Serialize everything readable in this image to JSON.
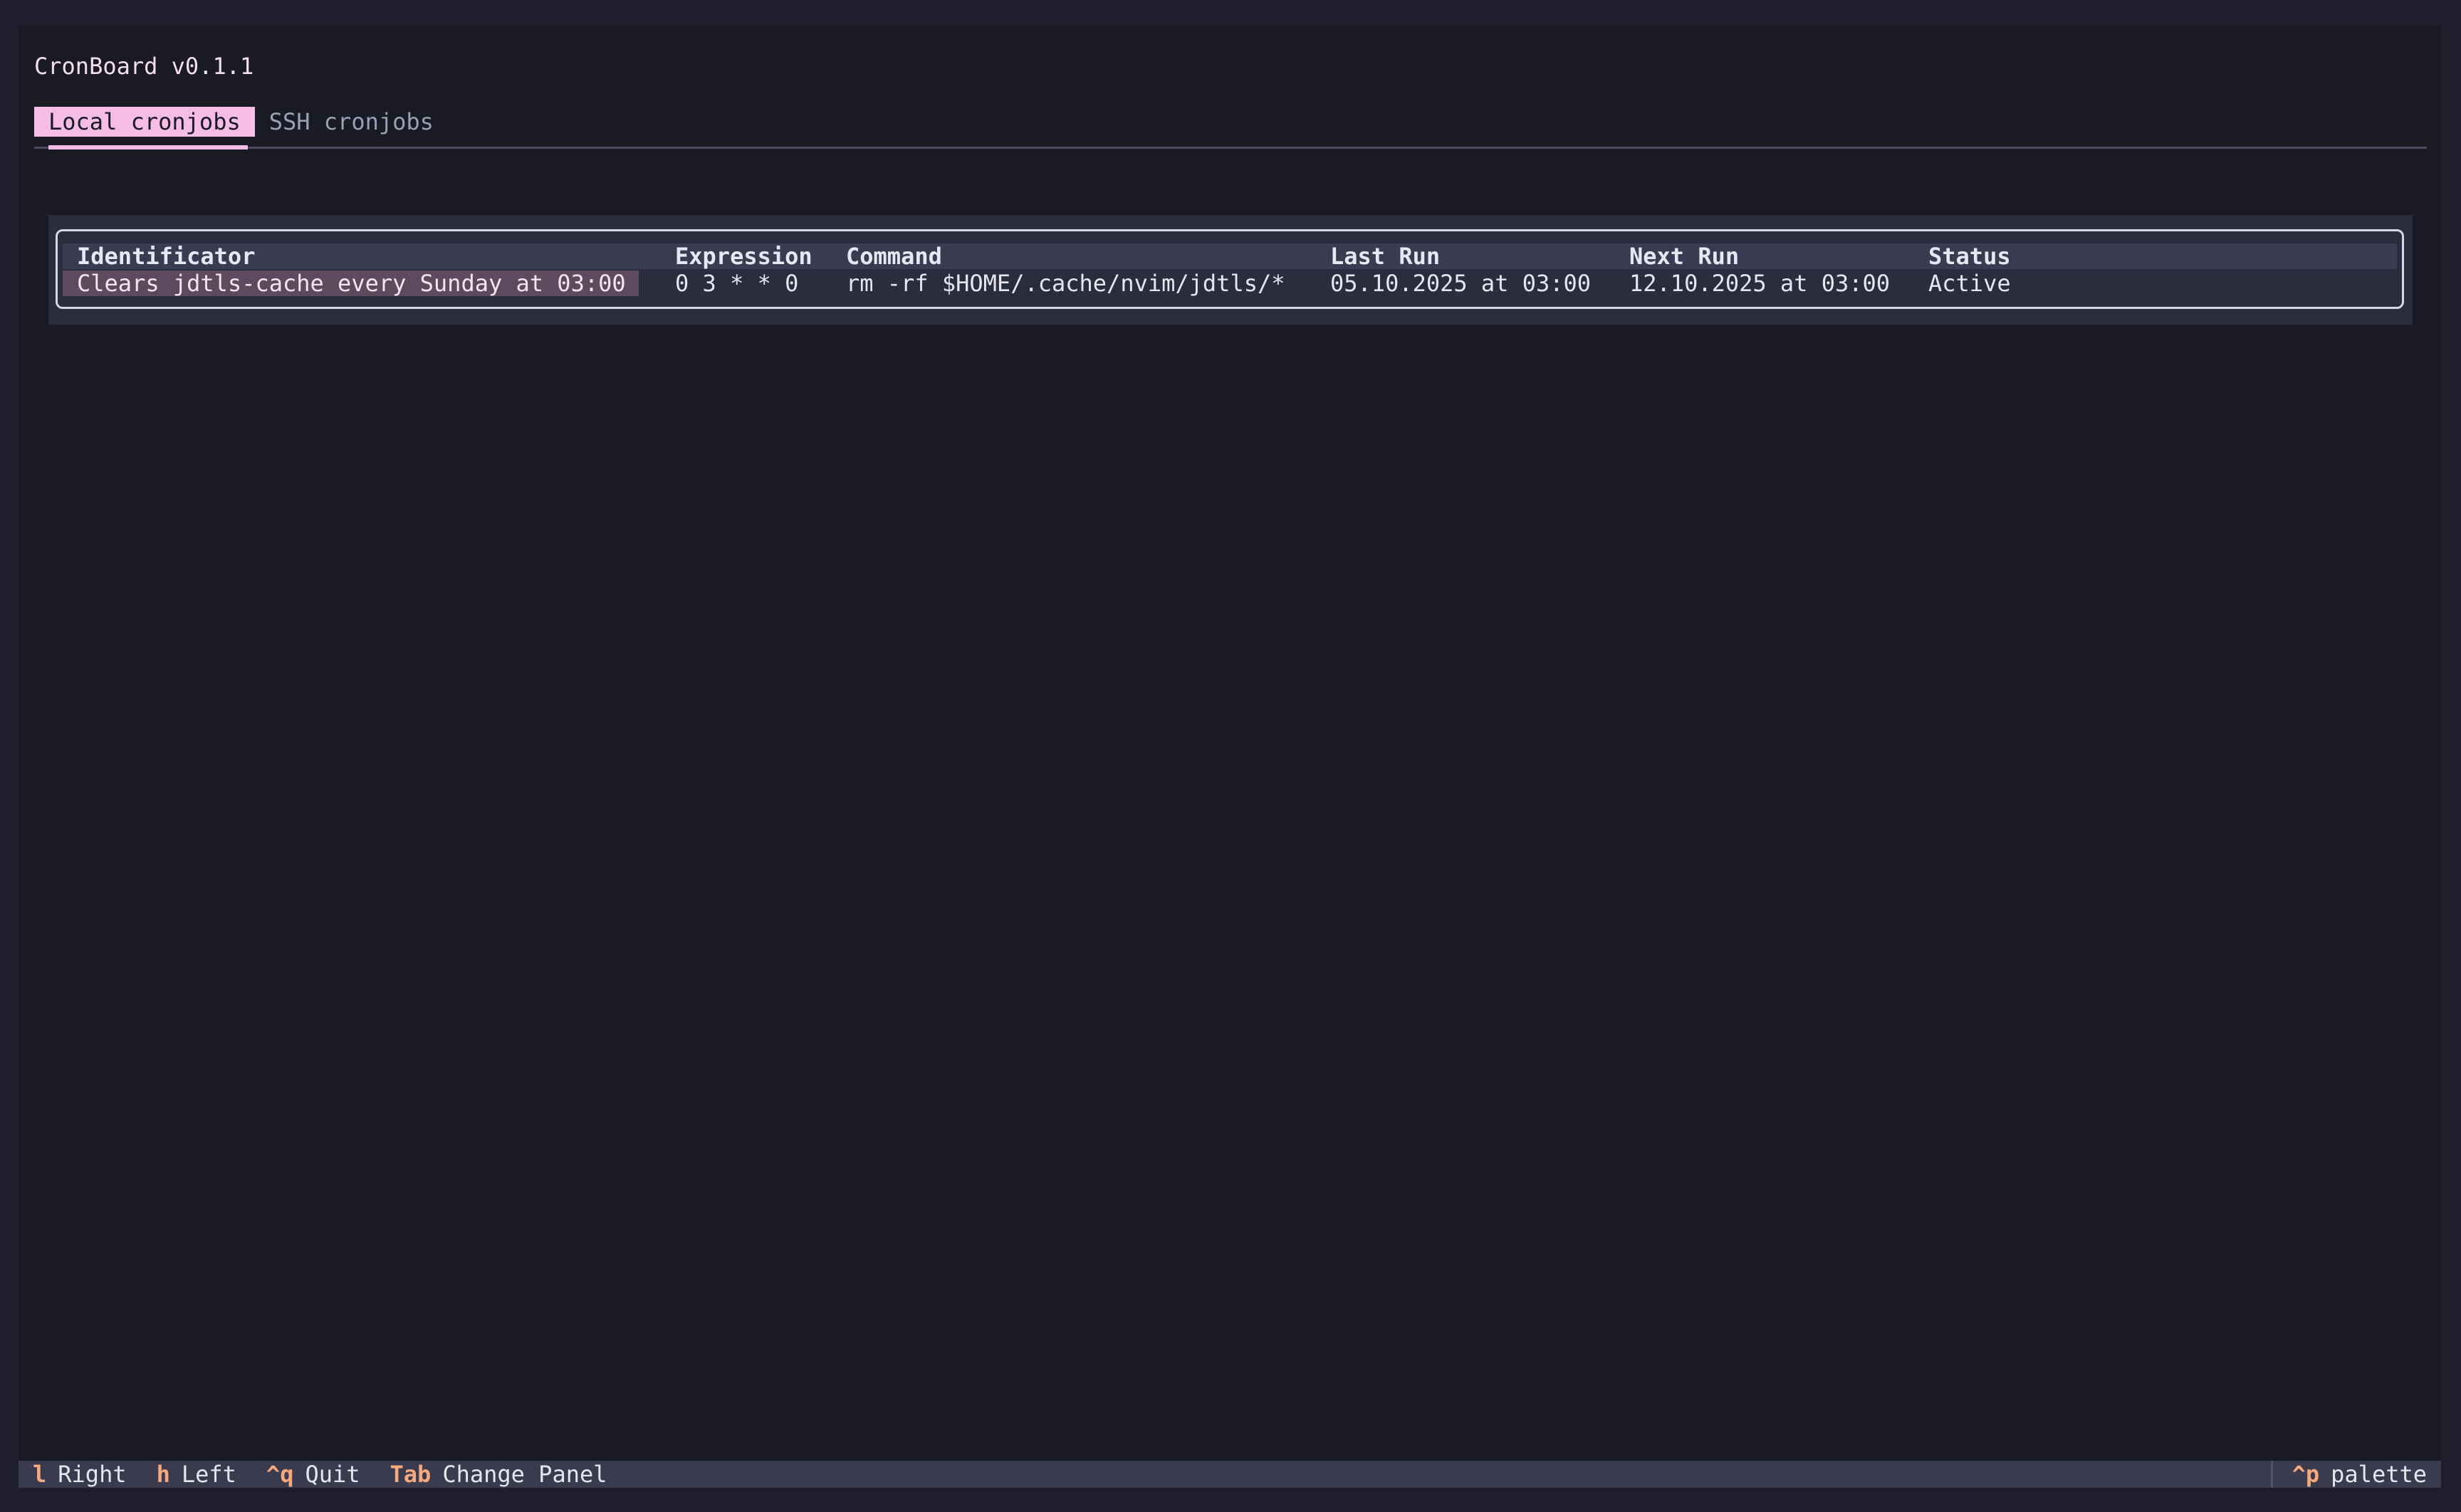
{
  "app": {
    "title": "CronBoard v0.1.1"
  },
  "tabs": [
    {
      "label": "Local cronjobs",
      "active": true
    },
    {
      "label": "SSH cronjobs",
      "active": false
    }
  ],
  "table": {
    "columns": [
      "Identificator",
      "Expression",
      "Command",
      "Last Run",
      "Next Run",
      "Status"
    ],
    "rows": [
      {
        "identificator": "Clears jdtls-cache every Sunday at 03:00",
        "expression": "0 3 * * 0",
        "command": "rm -rf $HOME/.cache/nvim/jdtls/*",
        "last_run": "05.10.2025 at 03:00",
        "next_run": "12.10.2025 at 03:00",
        "status": "Active"
      }
    ]
  },
  "footer": {
    "bindings": [
      {
        "key": "l",
        "desc": "Right"
      },
      {
        "key": "h",
        "desc": "Left"
      },
      {
        "key": "^q",
        "desc": "Quit"
      },
      {
        "key": "Tab",
        "desc": "Change Panel"
      }
    ],
    "palette": {
      "key": "^p",
      "desc": "palette"
    }
  },
  "colors": {
    "background": "#1a1a25",
    "accent_pink": "#f5bde6",
    "key_orange": "#f5a97f",
    "header_row": "#3a3b50",
    "selected_cell": "#5e4a5e"
  }
}
